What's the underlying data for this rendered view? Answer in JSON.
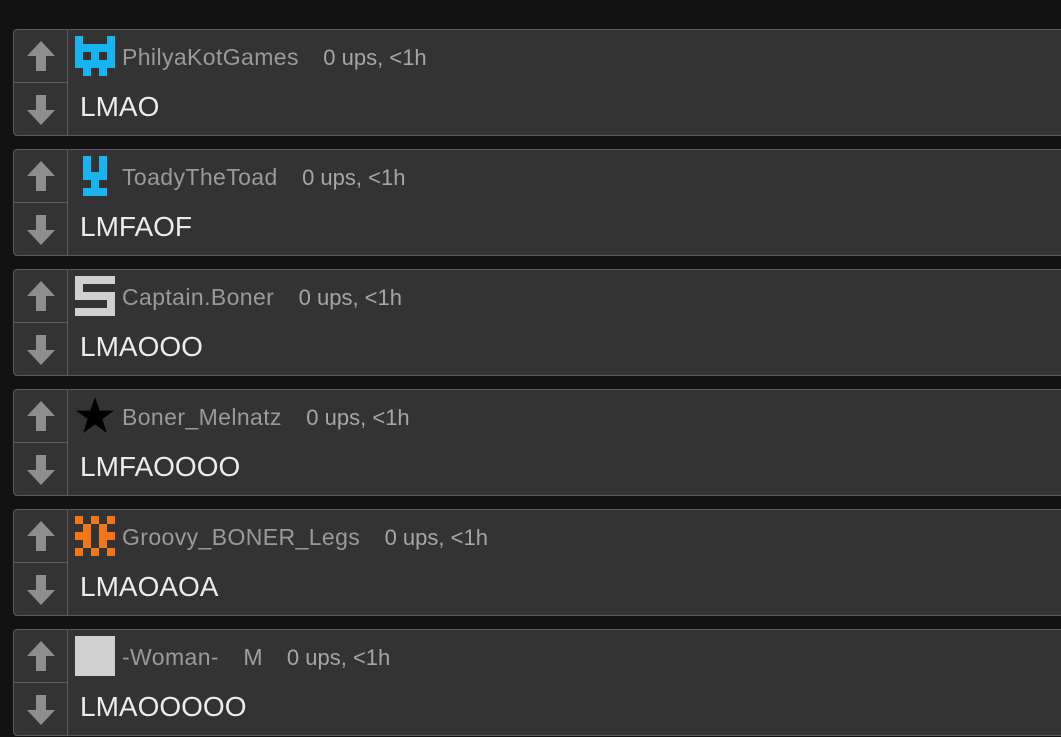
{
  "colors": {
    "background": "#121212",
    "card": "#333333",
    "border": "#5a5a5a",
    "arrow": "#8e8e8e",
    "avatar_blue": "#18b4f0",
    "avatar_gray": "#d0d0d0",
    "avatar_orange": "#f07818",
    "avatar_black": "#000000"
  },
  "comments": [
    {
      "username": "PhilyaKotGames",
      "tag": "",
      "stats": "0 ups, <1h",
      "text": "LMAO",
      "avatar_icon": "blue-cat-pixel-avatar"
    },
    {
      "username": "ToadyTheToad",
      "tag": "",
      "stats": "0 ups, <1h",
      "text": "LMFAOF",
      "avatar_icon": "blue-y-pixel-avatar"
    },
    {
      "username": "Captain.Boner",
      "tag": "",
      "stats": "0 ups, <1h",
      "text": "LMAOOO",
      "avatar_icon": "gray-s-pixel-avatar"
    },
    {
      "username": "Boner_Melnatz",
      "tag": "",
      "stats": "0 ups, <1h",
      "text": "LMFAOOOO",
      "avatar_icon": "black-star-avatar"
    },
    {
      "username": "Groovy_BONER_Legs",
      "tag": "",
      "stats": "0 ups, <1h",
      "text": "LMAOAOA",
      "avatar_icon": "orange-pixel-avatar"
    },
    {
      "username": "-Woman-",
      "tag": "M",
      "stats": "0 ups, <1h",
      "text": "LMAOOOOO",
      "avatar_icon": "gray-square-avatar"
    }
  ]
}
